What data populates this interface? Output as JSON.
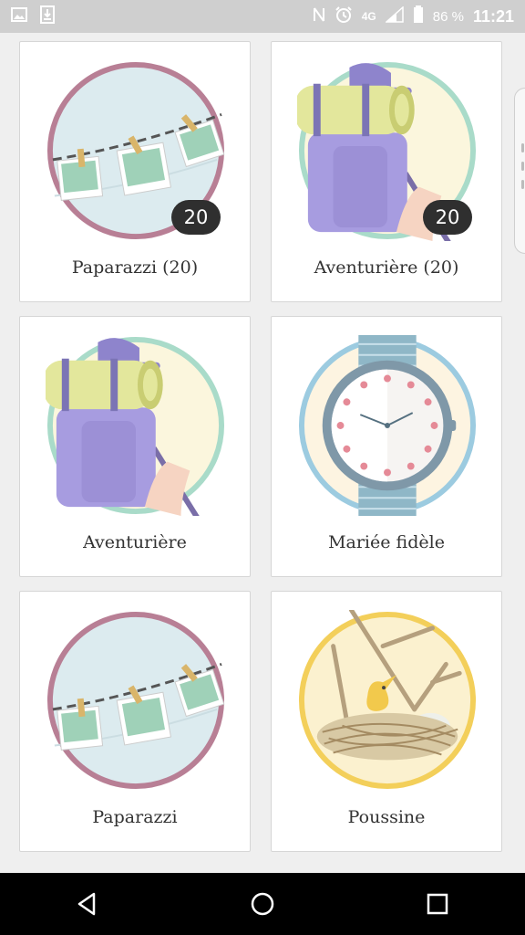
{
  "status_bar": {
    "network": "4G",
    "battery_percent": "86 %",
    "time": "11:21",
    "icons": [
      "image-icon",
      "download-icon",
      "nfc-icon",
      "alarm-icon",
      "signal-icon",
      "battery-icon"
    ]
  },
  "badges": [
    {
      "label": "Paparazzi (20)",
      "count": "20",
      "icon": "clothesline-photos-icon"
    },
    {
      "label": "Aventurière (20)",
      "count": "20",
      "icon": "backpacker-icon"
    },
    {
      "label": "Aventurière",
      "icon": "backpacker-icon"
    },
    {
      "label": "Mariée fidèle",
      "icon": "watch-hearts-icon"
    },
    {
      "label": "Paparazzi",
      "icon": "clothesline-photos-icon"
    },
    {
      "label": "Poussine",
      "icon": "chick-nest-icon"
    }
  ],
  "nav_bar": {
    "buttons": [
      "back-button",
      "home-button",
      "recents-button"
    ]
  },
  "colors": {
    "status_bar": "#cfcfcf",
    "card_border": "#d6d6d6",
    "pill": "#2f2f2f"
  }
}
